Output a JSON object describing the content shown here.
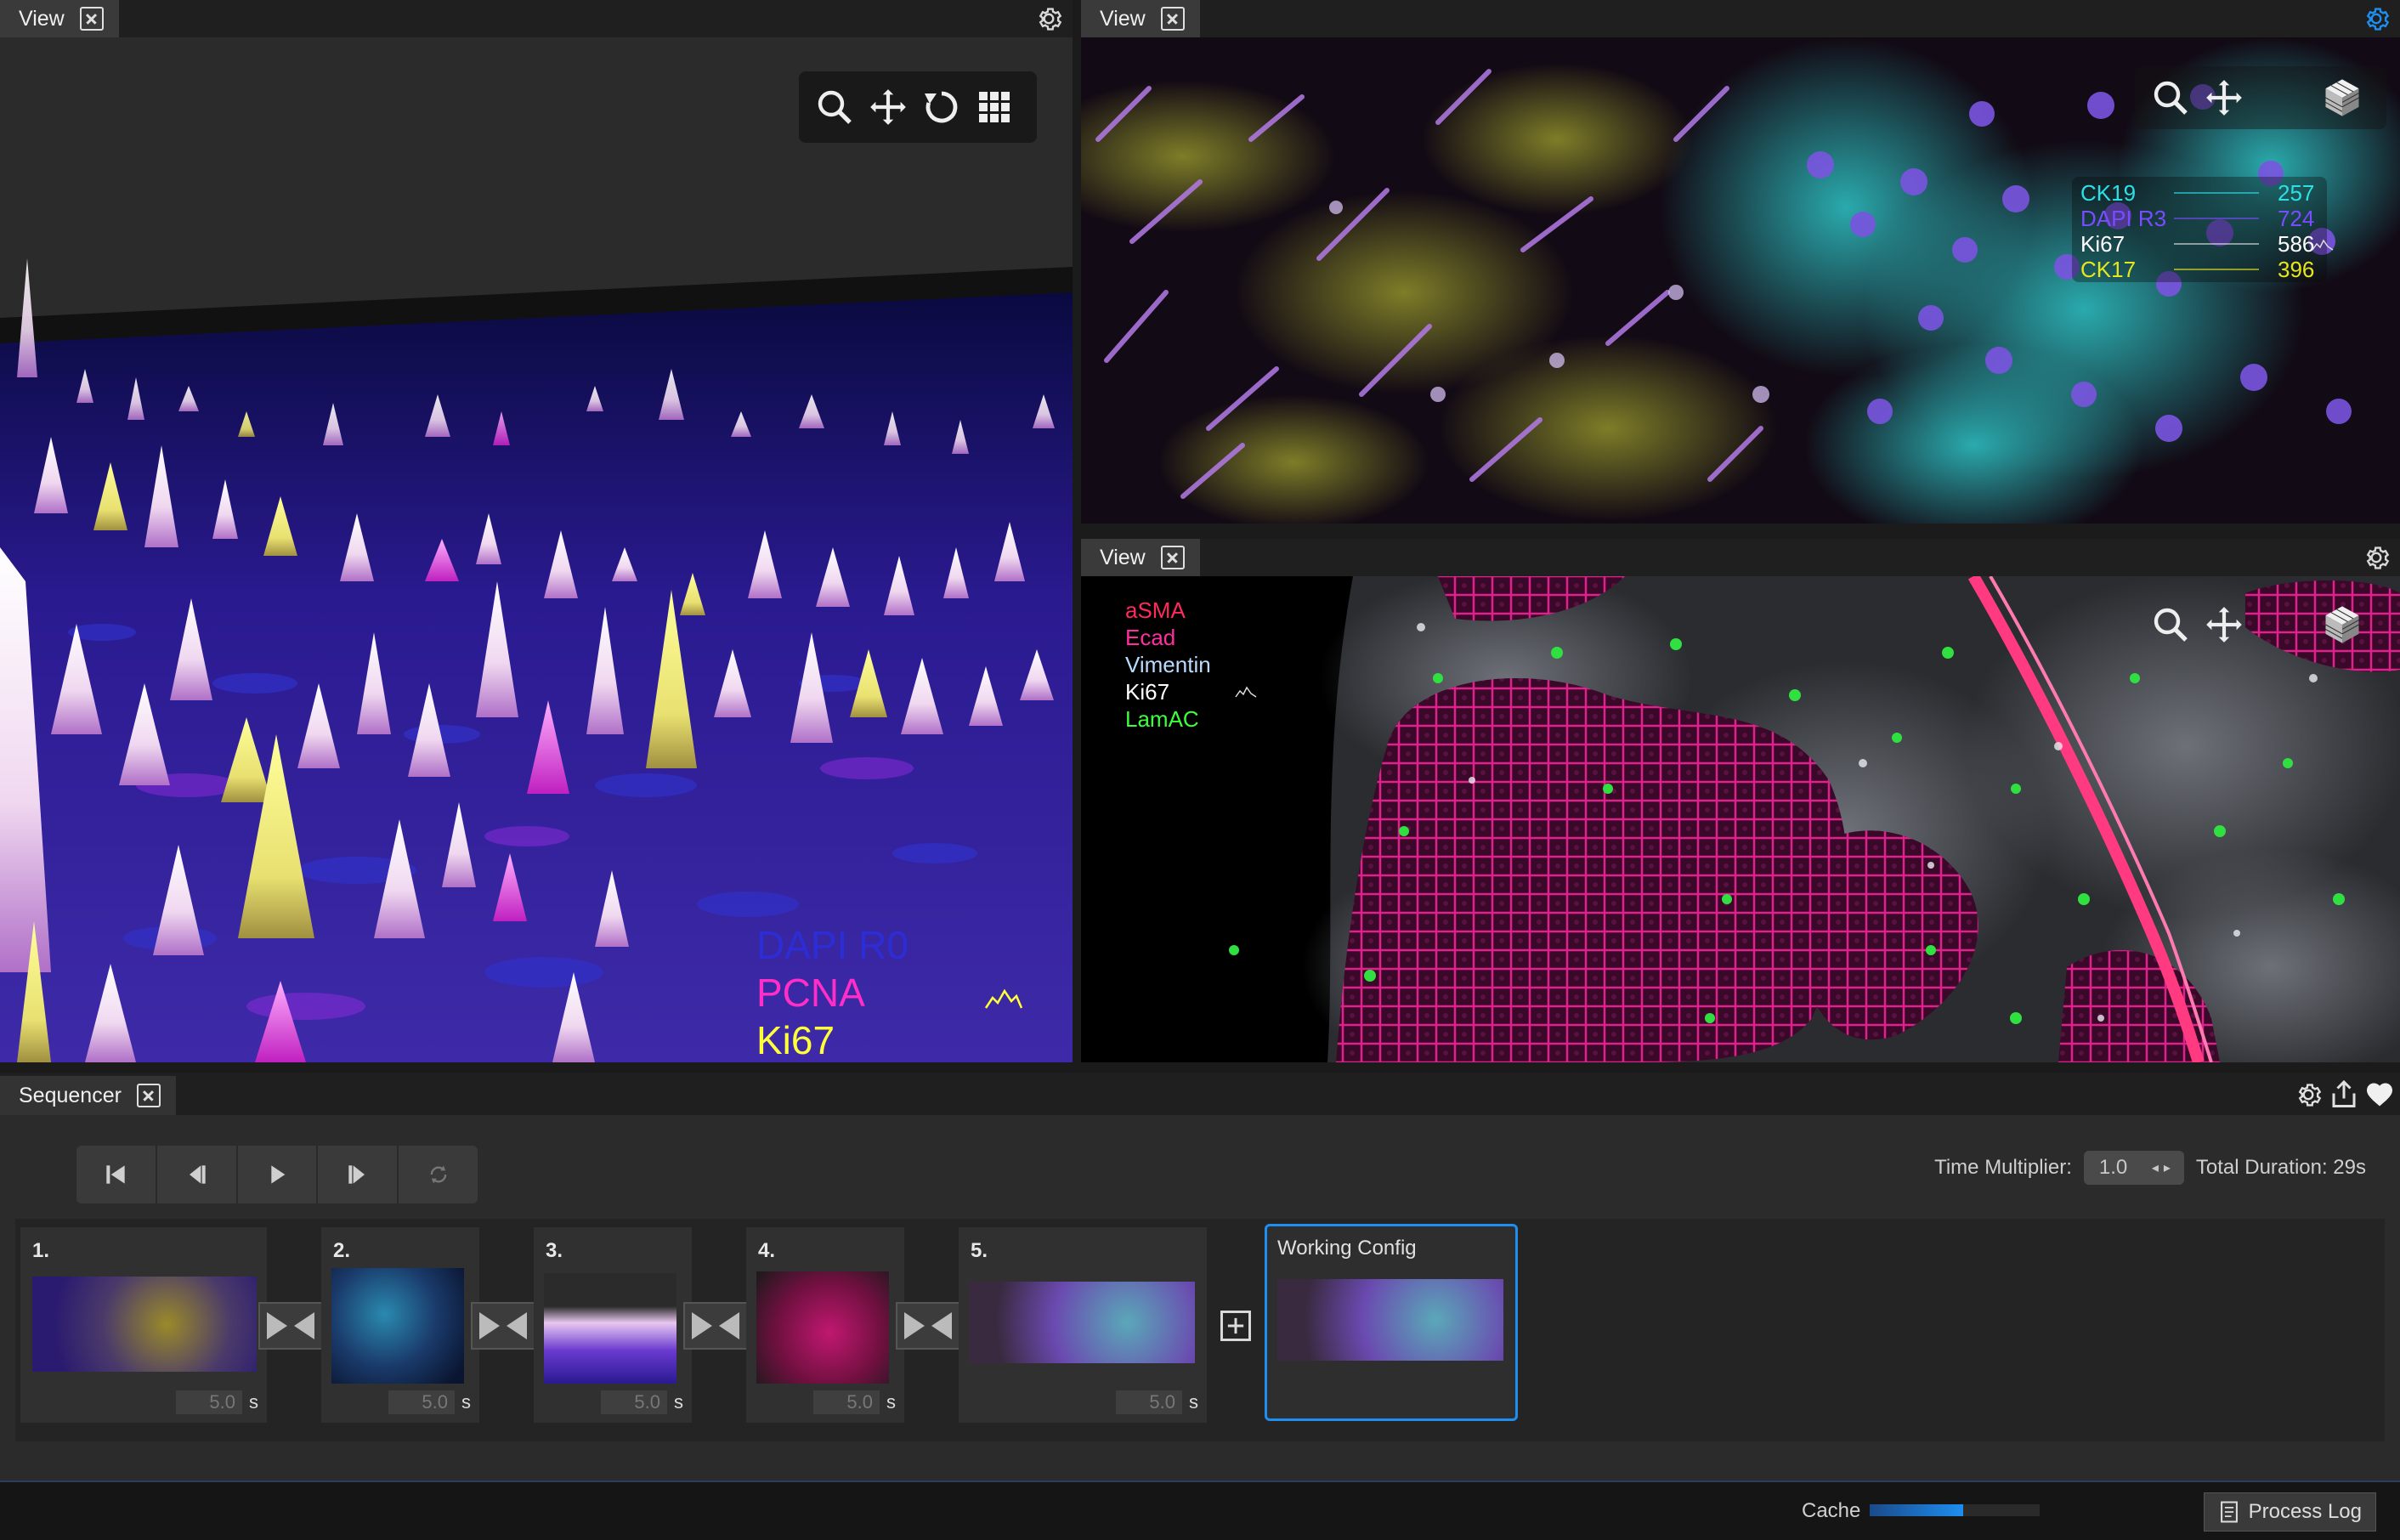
{
  "views": [
    {
      "tab_label": "View",
      "legend": [
        {
          "name": "DAPI R0",
          "color": "#2d2dd6"
        },
        {
          "name": "PCNA",
          "color": "#ff2ec8"
        },
        {
          "name": "Ki67",
          "color": "#ffff3c"
        }
      ]
    },
    {
      "tab_label": "View",
      "legend": [
        {
          "name": "CK19",
          "value": "257",
          "color": "#2ce0e6"
        },
        {
          "name": "DAPI R3",
          "value": "724",
          "color": "#7a4cff"
        },
        {
          "name": "Ki67",
          "value": "586",
          "color": "#ffffff"
        },
        {
          "name": "CK17",
          "value": "396",
          "color": "#e6e61e"
        }
      ]
    },
    {
      "tab_label": "View",
      "legend": [
        {
          "name": "aSMA",
          "color": "#ff2a5a"
        },
        {
          "name": "Ecad",
          "color": "#ff2ea0"
        },
        {
          "name": "Vimentin",
          "color": "#b8dcff"
        },
        {
          "name": "Ki67",
          "color": "#ffffff"
        },
        {
          "name": "LamAC",
          "color": "#3cff3c"
        }
      ]
    }
  ],
  "sequencer": {
    "tab_label": "Sequencer",
    "time_multiplier_label": "Time Multiplier:",
    "time_multiplier_value": "1.0",
    "total_duration": "Total Duration: 29s",
    "frames": [
      {
        "num": "1.",
        "duration": "5.0",
        "unit": "s"
      },
      {
        "num": "2.",
        "duration": "5.0",
        "unit": "s"
      },
      {
        "num": "3.",
        "duration": "5.0",
        "unit": "s"
      },
      {
        "num": "4.",
        "duration": "5.0",
        "unit": "s"
      },
      {
        "num": "5.",
        "duration": "5.0",
        "unit": "s"
      }
    ],
    "working_config_label": "Working Config"
  },
  "status": {
    "cache_label": "Cache",
    "cache_fraction": 0.55,
    "process_log_label": "Process Log"
  },
  "colors": {
    "accent": "#1e8ef0",
    "background": "#202020"
  }
}
